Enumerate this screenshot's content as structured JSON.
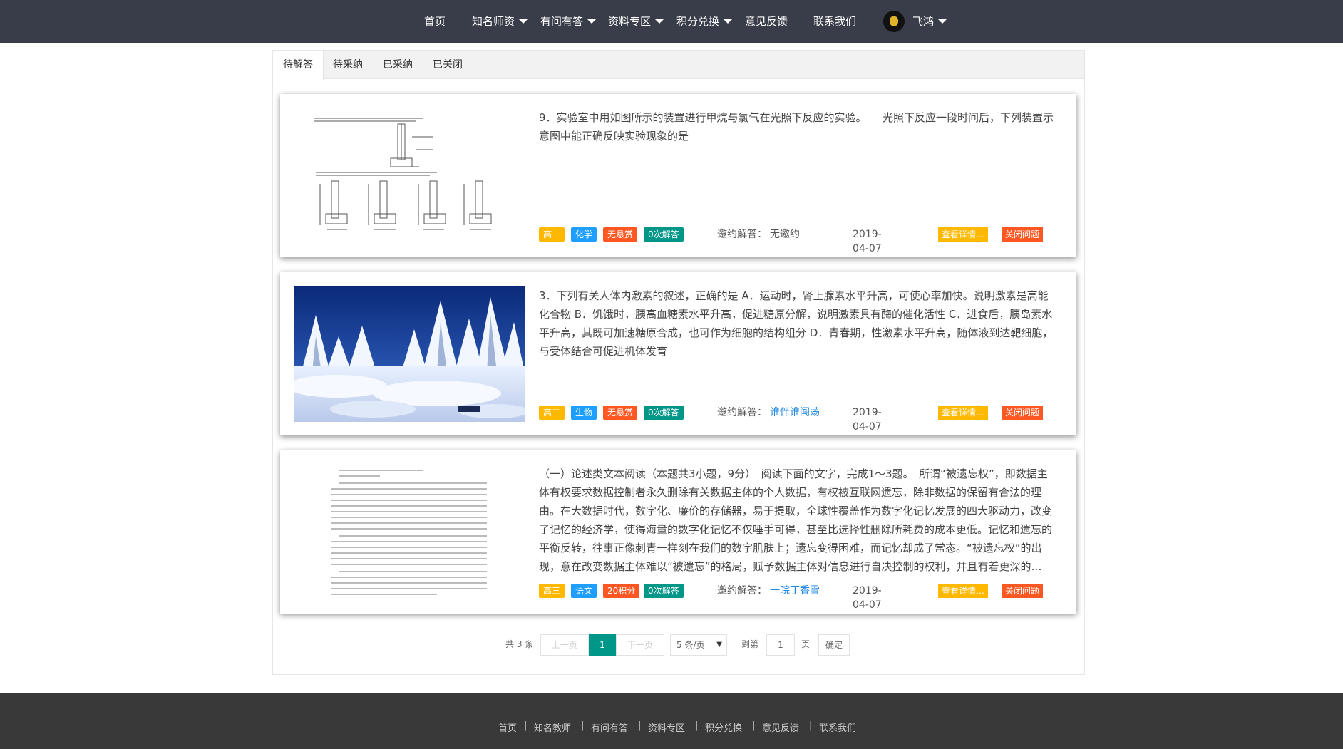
{
  "nav": {
    "home": "首页",
    "teachers": "知名师资",
    "qa": "有问有答",
    "resources": "资料专区",
    "points": "积分兑换",
    "feedback": "意见反馈",
    "contact": "联系我们",
    "user": "飞鸿"
  },
  "tabs": [
    "待解答",
    "待采纳",
    "已采纳",
    "已关闭"
  ],
  "questions": [
    {
      "text": "9．实验室中用如图所示的装置进行甲烷与氯气在光照下反应的实验。　　光照下反应一段时间后，下列装置示意图中能正确反映实验现象的是",
      "tags": [
        "高一",
        "化学",
        "无悬赏",
        "0次解答"
      ],
      "invite_label": "邀约解答：",
      "invite_name": "无邀约",
      "date": "2019-04-07",
      "detail": "查看详情…",
      "close": "关闭问题"
    },
    {
      "text": "3．下列有关人体内激素的叙述，正确的是  A．运动时，肾上腺素水平升高，可使心率加快。说明激素是高能化合物  B．饥饿时，胰高血糖素水平升高，促进糖原分解，说明激素具有酶的催化活性  C．进食后，胰岛素水平升高，其既可加速糖原合成，也可作为细胞的结构组分  D．青春期，性激素水平升高，随体液到达靶细胞，与受体结合可促进机体发育",
      "tags": [
        "高二",
        "生物",
        "无悬赏",
        "0次解答"
      ],
      "invite_label": "邀约解答：",
      "invite_name": "谁伴谁闯荡",
      "date": "2019-04-07",
      "detail": "查看详情…",
      "close": "关闭问题"
    },
    {
      "text": "（一）论述类文本阅读（本题共3小题，9分）　阅读下面的文字，完成1～3题。　所谓“被遗忘权”，即数据主体有权要求数据控制者永久删除有关数据主体的个人数据，有权被互联网遗忘，除非数据的保留有合法的理由。在大数据时代，数字化、廉价的存储器，易于提取，全球性覆盖作为数字化记忆发展的四大驱动力，改变了记忆的经济学，使得海量的数字化记忆不仅唾手可得，甚至比选择性删除所耗费的成本更低。记忆和遗忘的平衡反转，往事正像刺青一样刻在我们的数字肌肤上；遗忘变得困难，而记忆却成了常态。“被遗忘权”的出现，意在改变数据主体难以“被遗忘”的格局，赋予数据主体对信息进行自决控制的权利，并且有着更深的…",
      "tags": [
        "高三",
        "语文",
        "20积分",
        "0次解答"
      ],
      "invite_label": "邀约解答：",
      "invite_name": "一晥丁香雪",
      "date": "2019-04-07",
      "detail": "查看详情…",
      "close": "关闭问题"
    }
  ],
  "pager": {
    "total": "共 3 条",
    "prev": "上一页",
    "current": "1",
    "next": "下一页",
    "per_page": "5 条/页",
    "goto": "到第",
    "page_input": "1",
    "page_unit": "页",
    "confirm": "确定"
  },
  "footer": [
    "首页",
    "知名教师",
    "有问有答",
    "资料专区",
    "积分兑换",
    "意见反馈",
    "联系我们"
  ],
  "colors": {
    "nav_bg": "#393d49",
    "footer_bg": "#393939",
    "orange": "#ffb800",
    "blue": "#1e9fff",
    "red": "#ff5722",
    "green": "#009688"
  }
}
